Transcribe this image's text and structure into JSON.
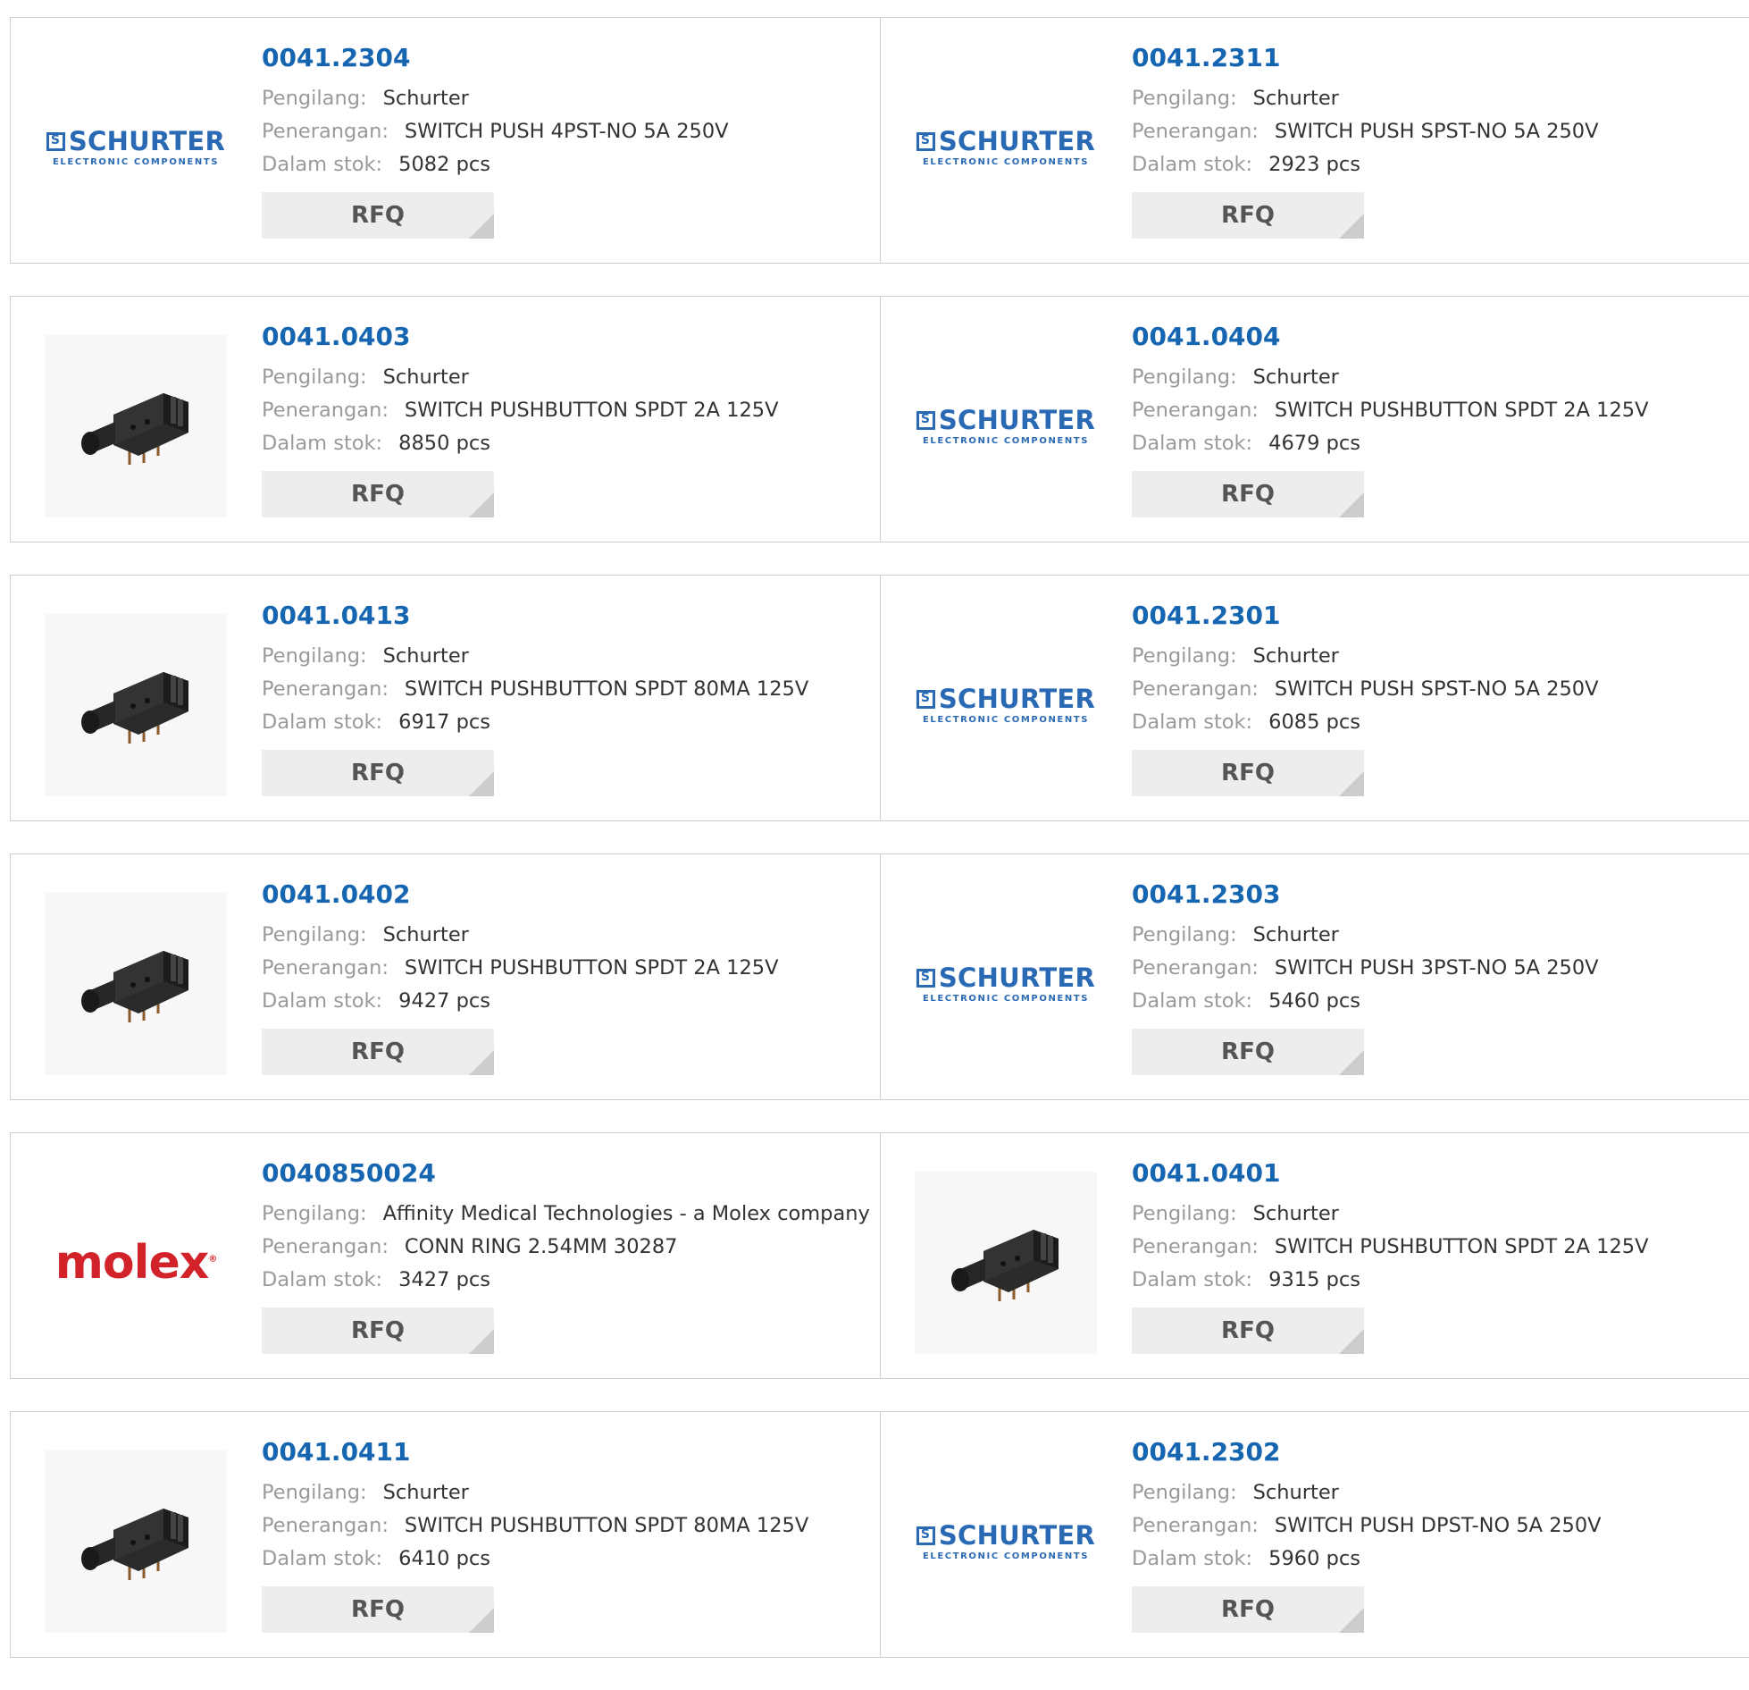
{
  "labels": {
    "manufacturer": "Pengilang:",
    "description": "Penerangan:",
    "stock": "Dalam stok:",
    "rfq": "RFQ"
  },
  "logos": {
    "schurter_main": "SCHURTER",
    "schurter_sub": "ELECTRONIC COMPONENTS",
    "molex": "molex"
  },
  "colors": {
    "part_link": "#1565b0",
    "label_grey": "#9a9a9a",
    "rfq_bg": "#ededed",
    "schurter_blue": "#2a6ab5",
    "molex_red": "#d2222a"
  },
  "products": [
    {
      "part": "0041.2304",
      "manufacturer": "Schurter",
      "description": "SWITCH PUSH 4PST-NO 5A 250V",
      "stock": "5082 pcs",
      "image": "schurter-logo"
    },
    {
      "part": "0041.2311",
      "manufacturer": "Schurter",
      "description": "SWITCH PUSH SPST-NO 5A 250V",
      "stock": "2923 pcs",
      "image": "schurter-logo"
    },
    {
      "part": "0041.0403",
      "manufacturer": "Schurter",
      "description": "SWITCH PUSHBUTTON SPDT 2A 125V",
      "stock": "8850 pcs",
      "image": "pushbutton-switch-photo"
    },
    {
      "part": "0041.0404",
      "manufacturer": "Schurter",
      "description": "SWITCH PUSHBUTTON SPDT 2A 125V",
      "stock": "4679 pcs",
      "image": "schurter-logo"
    },
    {
      "part": "0041.0413",
      "manufacturer": "Schurter",
      "description": "SWITCH PUSHBUTTON SPDT 80MA 125V",
      "stock": "6917 pcs",
      "image": "pushbutton-switch-photo"
    },
    {
      "part": "0041.2301",
      "manufacturer": "Schurter",
      "description": "SWITCH PUSH SPST-NO 5A 250V",
      "stock": "6085 pcs",
      "image": "schurter-logo"
    },
    {
      "part": "0041.0402",
      "manufacturer": "Schurter",
      "description": "SWITCH PUSHBUTTON SPDT 2A 125V",
      "stock": "9427 pcs",
      "image": "pushbutton-switch-photo"
    },
    {
      "part": "0041.2303",
      "manufacturer": "Schurter",
      "description": "SWITCH PUSH 3PST-NO 5A 250V",
      "stock": "5460 pcs",
      "image": "schurter-logo"
    },
    {
      "part": "0040850024",
      "manufacturer": "Affinity Medical Technologies - a Molex company",
      "description": "CONN RING 2.54MM 30287",
      "stock": "3427 pcs",
      "image": "molex-logo"
    },
    {
      "part": "0041.0401",
      "manufacturer": "Schurter",
      "description": "SWITCH PUSHBUTTON SPDT 2A 125V",
      "stock": "9315 pcs",
      "image": "pushbutton-switch-photo"
    },
    {
      "part": "0041.0411",
      "manufacturer": "Schurter",
      "description": "SWITCH PUSHBUTTON SPDT 80MA 125V",
      "stock": "6410 pcs",
      "image": "pushbutton-switch-photo"
    },
    {
      "part": "0041.2302",
      "manufacturer": "Schurter",
      "description": "SWITCH PUSH DPST-NO 5A 250V",
      "stock": "5960 pcs",
      "image": "schurter-logo"
    }
  ]
}
